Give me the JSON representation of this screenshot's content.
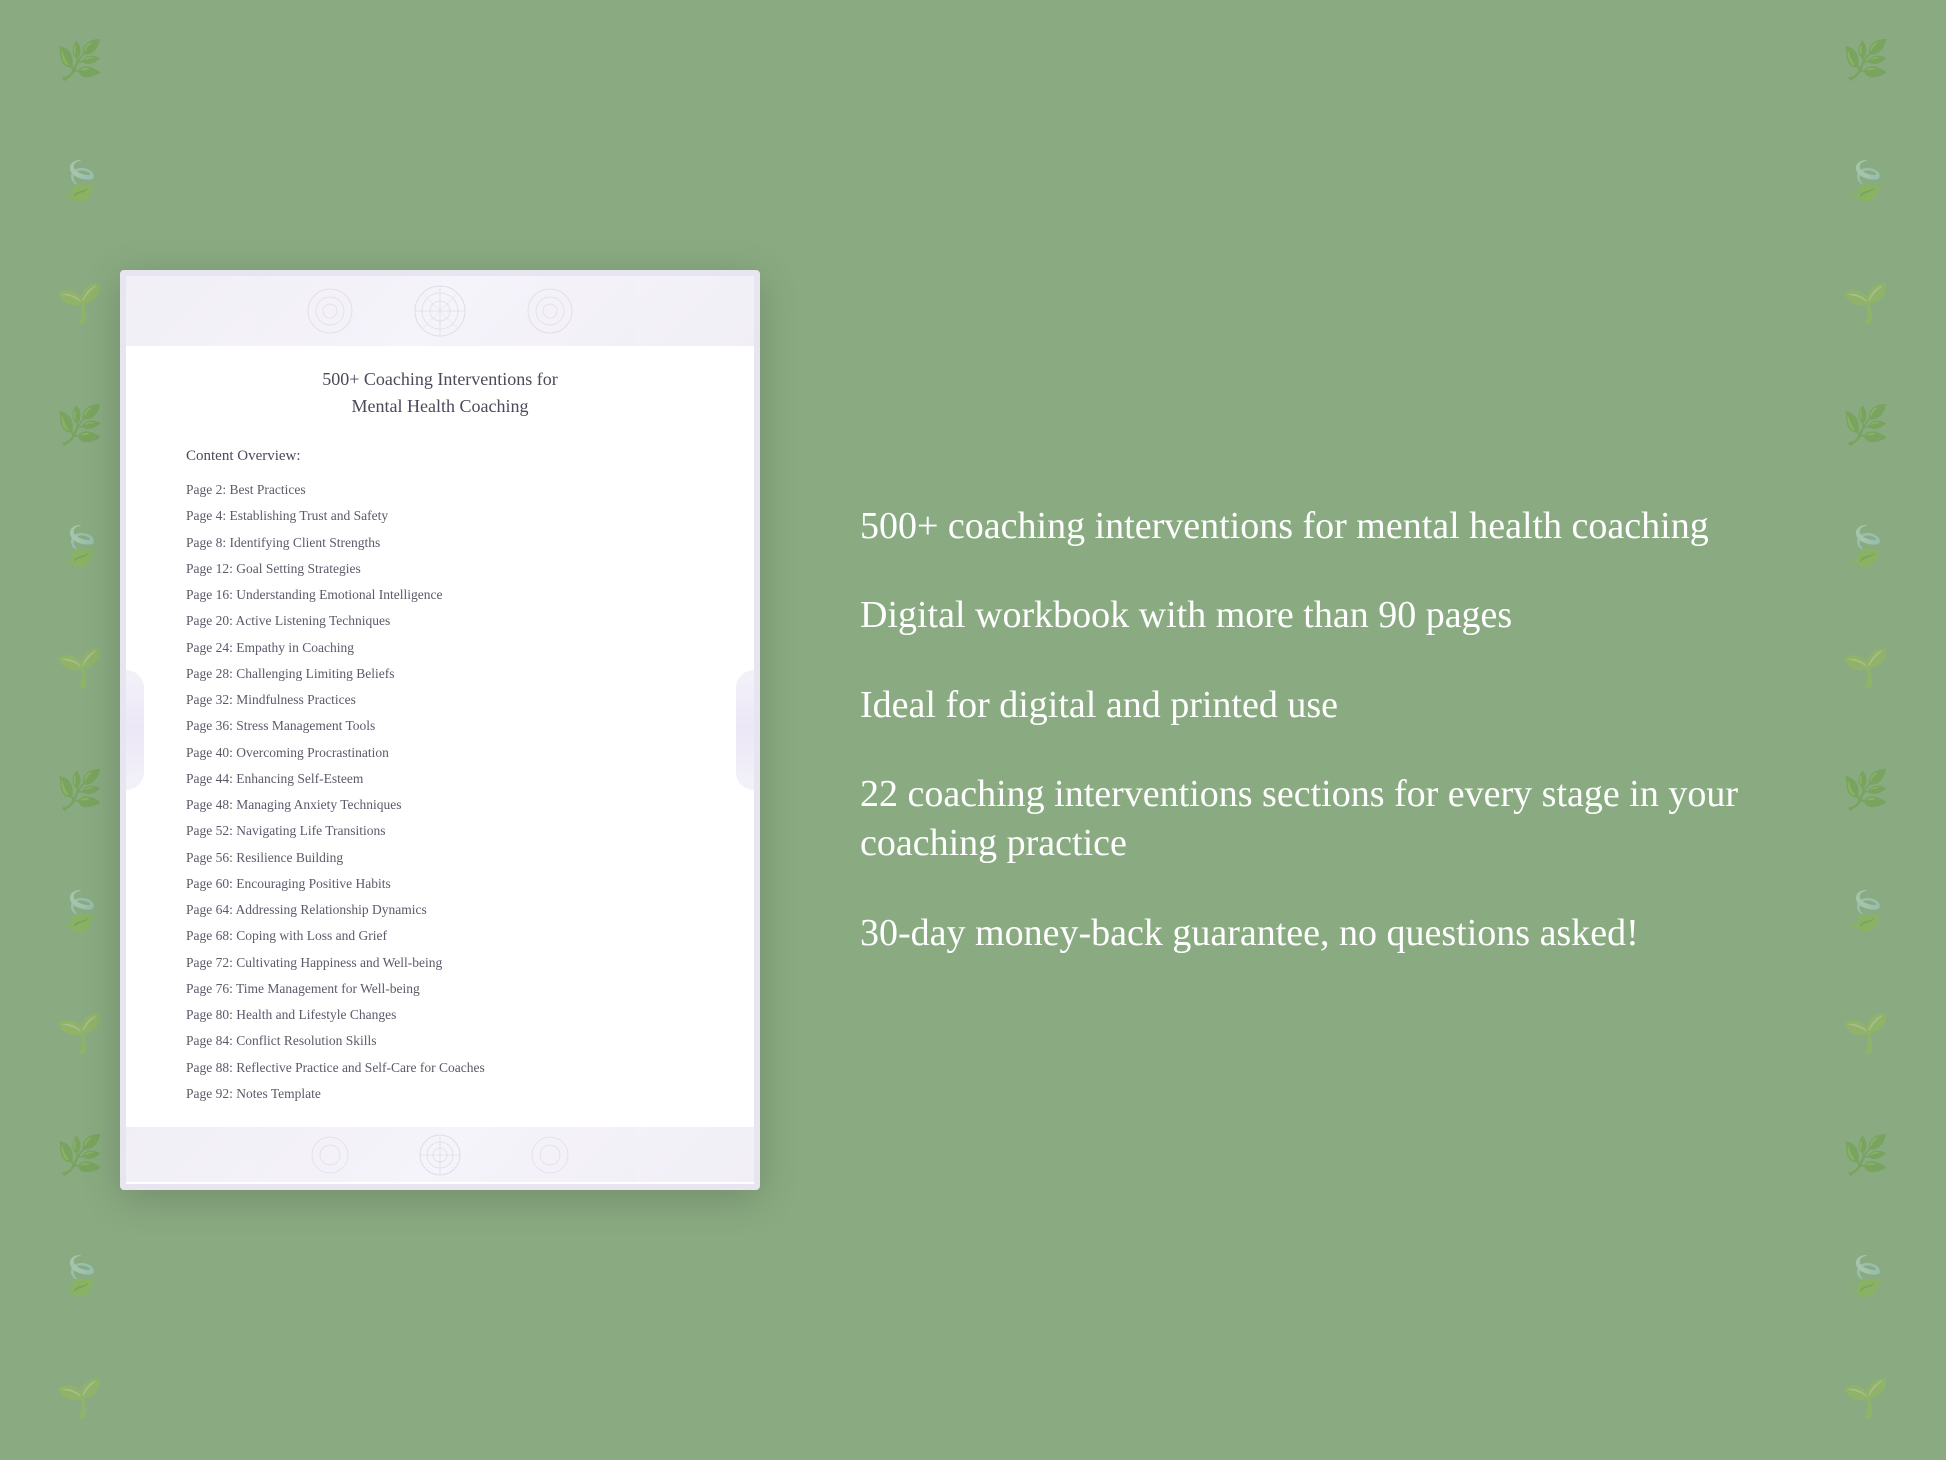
{
  "background_color": "#8aab82",
  "document": {
    "title_line1": "500+ Coaching Interventions for",
    "title_line2": "Mental Health Coaching",
    "content_label": "Content Overview:",
    "toc_items": [
      {
        "page": "Page  2:",
        "title": "Best Practices"
      },
      {
        "page": "Page  4:",
        "title": "Establishing Trust and Safety"
      },
      {
        "page": "Page  8:",
        "title": "Identifying Client Strengths"
      },
      {
        "page": "Page 12:",
        "title": "Goal Setting Strategies"
      },
      {
        "page": "Page 16:",
        "title": "Understanding Emotional Intelligence"
      },
      {
        "page": "Page 20:",
        "title": "Active Listening Techniques"
      },
      {
        "page": "Page 24:",
        "title": "Empathy in Coaching"
      },
      {
        "page": "Page 28:",
        "title": "Challenging Limiting Beliefs"
      },
      {
        "page": "Page 32:",
        "title": "Mindfulness Practices"
      },
      {
        "page": "Page 36:",
        "title": "Stress Management Tools"
      },
      {
        "page": "Page 40:",
        "title": "Overcoming Procrastination"
      },
      {
        "page": "Page 44:",
        "title": "Enhancing Self-Esteem"
      },
      {
        "page": "Page 48:",
        "title": "Managing Anxiety Techniques"
      },
      {
        "page": "Page 52:",
        "title": "Navigating Life Transitions"
      },
      {
        "page": "Page 56:",
        "title": "Resilience Building"
      },
      {
        "page": "Page 60:",
        "title": "Encouraging Positive Habits"
      },
      {
        "page": "Page 64:",
        "title": "Addressing Relationship Dynamics"
      },
      {
        "page": "Page 68:",
        "title": "Coping with Loss and Grief"
      },
      {
        "page": "Page 72:",
        "title": "Cultivating Happiness and Well-being"
      },
      {
        "page": "Page 76:",
        "title": "Time Management for Well-being"
      },
      {
        "page": "Page 80:",
        "title": "Health and Lifestyle Changes"
      },
      {
        "page": "Page 84:",
        "title": "Conflict Resolution Skills"
      },
      {
        "page": "Page 88:",
        "title": "Reflective Practice and Self-Care for Coaches"
      },
      {
        "page": "Page 92:",
        "title": "Notes Template"
      }
    ]
  },
  "features": [
    "500+ coaching interventions for mental health coaching",
    "Digital workbook with more than 90 pages",
    "Ideal for digital and printed use",
    "22 coaching interventions sections for every stage in your coaching practice",
    "30-day money-back guarantee, no questions asked!"
  ],
  "leaf_symbols": [
    "🌿",
    "🍃",
    "🌱",
    "🌿",
    "🍃",
    "🌱",
    "🌿",
    "🍃",
    "🌱",
    "🌿",
    "🍃",
    "🌱"
  ]
}
